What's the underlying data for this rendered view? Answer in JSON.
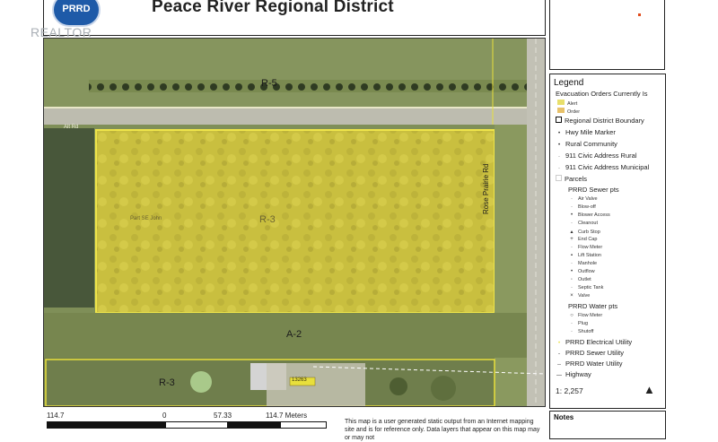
{
  "header": {
    "title": "Peace River Regional District",
    "logo_text": "PRRD",
    "watermark": "REALTOR"
  },
  "map": {
    "zone_labels": [
      "R-5",
      "R-3",
      "A-2",
      "R-3"
    ],
    "road_label": "Rose Prairie Rd",
    "road_small": "Alt Rd",
    "parcel_text": "Part SE John",
    "address_marker": "13263"
  },
  "legend": {
    "title": "Legend",
    "evac_heading": "Evacuation Orders Currently Is",
    "evac_items": [
      "Alert",
      "Order"
    ],
    "layers": [
      "Regional District Boundary",
      "Hwy Mile Marker",
      "Rural Community",
      "911 Civic Address Rural",
      "911 Civic Address Municipal",
      "Parcels",
      "PRRD Sewer pts"
    ],
    "sewer_points": [
      "Air Valve",
      "Blow-off",
      "Blower Access",
      "Cleanout",
      "Curb Stop",
      "End Cap",
      "Flow Meter",
      "Lift Station",
      "Manhole",
      "Outflow",
      "Outlet",
      "Septic Tank",
      "Valve"
    ],
    "water_heading": "PRRD Water pts",
    "water_points": [
      "Flow Meter",
      "Plug",
      "Shutoff"
    ],
    "utilities": [
      "PRRD Electrical Utility",
      "PRRD Sewer Utility",
      "PRRD Water Utility",
      "Highway"
    ],
    "scale_ratio": "1: 2,257",
    "north_icon": "north-arrow-icon"
  },
  "scale_bar": {
    "labels": [
      "114.7",
      "0",
      "57.33",
      "114.7 Meters"
    ]
  },
  "disclaimer": "This map is a user generated static output from an Internet mapping site and is for reference only. Data layers that appear on this map may or may not",
  "notes": {
    "label": "Notes"
  },
  "colors": {
    "parcel_fill": "#d9cf3a",
    "parcel_border": "#e8df3c",
    "road": "#c9c8bd",
    "field": "#7c8b55"
  }
}
